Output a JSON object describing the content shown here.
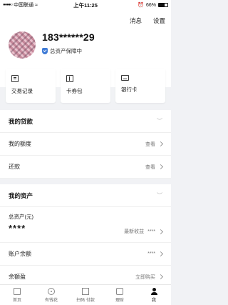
{
  "status_bar": {
    "carrier": "中国联通",
    "time": "上午11:25",
    "battery": "66%"
  },
  "header": {
    "messages": "消息",
    "settings": "设置",
    "phone": "183******29",
    "protection": "总资产保障中"
  },
  "quick_cards": [
    {
      "label": "交易记录",
      "icon": "transaction-record-icon"
    },
    {
      "label": "卡券包",
      "icon": "coupon-icon"
    },
    {
      "label": "银行卡",
      "icon": "bank-card-icon"
    }
  ],
  "loans": {
    "title": "我的贷款",
    "rows": [
      {
        "label": "我的额度",
        "action": "查看"
      },
      {
        "label": "还款",
        "action": "查看"
      }
    ]
  },
  "assets": {
    "title": "我的资产",
    "total_label": "总资产(元)",
    "total_value": "****",
    "latest_income_label": "最新收益",
    "latest_income_value": "****",
    "balance_label": "账户余额",
    "balance_value": "****",
    "yuebao_label": "余额盈",
    "yuebao_action": "立即购买"
  },
  "tab_bar": [
    {
      "label": "首页",
      "icon": "home-icon"
    },
    {
      "label": "有钱花",
      "icon": "wallet-icon"
    },
    {
      "label": "扫码 付款",
      "icon": "scan-icon"
    },
    {
      "label": "理财",
      "icon": "finance-icon"
    },
    {
      "label": "我",
      "icon": "me-icon",
      "active": true
    }
  ]
}
